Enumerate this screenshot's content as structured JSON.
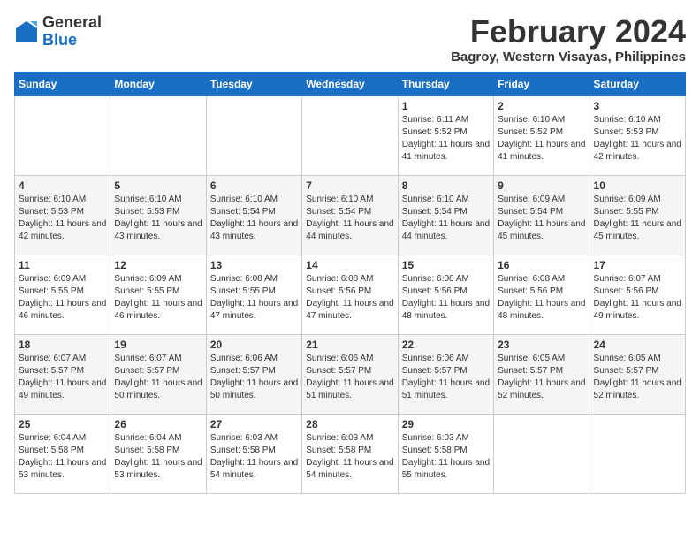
{
  "header": {
    "logo_general": "General",
    "logo_blue": "Blue",
    "month_year": "February 2024",
    "location": "Bagroy, Western Visayas, Philippines"
  },
  "calendar": {
    "days_of_week": [
      "Sunday",
      "Monday",
      "Tuesday",
      "Wednesday",
      "Thursday",
      "Friday",
      "Saturday"
    ],
    "weeks": [
      [
        {
          "day": "",
          "info": ""
        },
        {
          "day": "",
          "info": ""
        },
        {
          "day": "",
          "info": ""
        },
        {
          "day": "",
          "info": ""
        },
        {
          "day": "1",
          "info": "Sunrise: 6:11 AM\nSunset: 5:52 PM\nDaylight: 11 hours and 41 minutes."
        },
        {
          "day": "2",
          "info": "Sunrise: 6:10 AM\nSunset: 5:52 PM\nDaylight: 11 hours and 41 minutes."
        },
        {
          "day": "3",
          "info": "Sunrise: 6:10 AM\nSunset: 5:53 PM\nDaylight: 11 hours and 42 minutes."
        }
      ],
      [
        {
          "day": "4",
          "info": "Sunrise: 6:10 AM\nSunset: 5:53 PM\nDaylight: 11 hours and 42 minutes."
        },
        {
          "day": "5",
          "info": "Sunrise: 6:10 AM\nSunset: 5:53 PM\nDaylight: 11 hours and 43 minutes."
        },
        {
          "day": "6",
          "info": "Sunrise: 6:10 AM\nSunset: 5:54 PM\nDaylight: 11 hours and 43 minutes."
        },
        {
          "day": "7",
          "info": "Sunrise: 6:10 AM\nSunset: 5:54 PM\nDaylight: 11 hours and 44 minutes."
        },
        {
          "day": "8",
          "info": "Sunrise: 6:10 AM\nSunset: 5:54 PM\nDaylight: 11 hours and 44 minutes."
        },
        {
          "day": "9",
          "info": "Sunrise: 6:09 AM\nSunset: 5:54 PM\nDaylight: 11 hours and 45 minutes."
        },
        {
          "day": "10",
          "info": "Sunrise: 6:09 AM\nSunset: 5:55 PM\nDaylight: 11 hours and 45 minutes."
        }
      ],
      [
        {
          "day": "11",
          "info": "Sunrise: 6:09 AM\nSunset: 5:55 PM\nDaylight: 11 hours and 46 minutes."
        },
        {
          "day": "12",
          "info": "Sunrise: 6:09 AM\nSunset: 5:55 PM\nDaylight: 11 hours and 46 minutes."
        },
        {
          "day": "13",
          "info": "Sunrise: 6:08 AM\nSunset: 5:55 PM\nDaylight: 11 hours and 47 minutes."
        },
        {
          "day": "14",
          "info": "Sunrise: 6:08 AM\nSunset: 5:56 PM\nDaylight: 11 hours and 47 minutes."
        },
        {
          "day": "15",
          "info": "Sunrise: 6:08 AM\nSunset: 5:56 PM\nDaylight: 11 hours and 48 minutes."
        },
        {
          "day": "16",
          "info": "Sunrise: 6:08 AM\nSunset: 5:56 PM\nDaylight: 11 hours and 48 minutes."
        },
        {
          "day": "17",
          "info": "Sunrise: 6:07 AM\nSunset: 5:56 PM\nDaylight: 11 hours and 49 minutes."
        }
      ],
      [
        {
          "day": "18",
          "info": "Sunrise: 6:07 AM\nSunset: 5:57 PM\nDaylight: 11 hours and 49 minutes."
        },
        {
          "day": "19",
          "info": "Sunrise: 6:07 AM\nSunset: 5:57 PM\nDaylight: 11 hours and 50 minutes."
        },
        {
          "day": "20",
          "info": "Sunrise: 6:06 AM\nSunset: 5:57 PM\nDaylight: 11 hours and 50 minutes."
        },
        {
          "day": "21",
          "info": "Sunrise: 6:06 AM\nSunset: 5:57 PM\nDaylight: 11 hours and 51 minutes."
        },
        {
          "day": "22",
          "info": "Sunrise: 6:06 AM\nSunset: 5:57 PM\nDaylight: 11 hours and 51 minutes."
        },
        {
          "day": "23",
          "info": "Sunrise: 6:05 AM\nSunset: 5:57 PM\nDaylight: 11 hours and 52 minutes."
        },
        {
          "day": "24",
          "info": "Sunrise: 6:05 AM\nSunset: 5:57 PM\nDaylight: 11 hours and 52 minutes."
        }
      ],
      [
        {
          "day": "25",
          "info": "Sunrise: 6:04 AM\nSunset: 5:58 PM\nDaylight: 11 hours and 53 minutes."
        },
        {
          "day": "26",
          "info": "Sunrise: 6:04 AM\nSunset: 5:58 PM\nDaylight: 11 hours and 53 minutes."
        },
        {
          "day": "27",
          "info": "Sunrise: 6:03 AM\nSunset: 5:58 PM\nDaylight: 11 hours and 54 minutes."
        },
        {
          "day": "28",
          "info": "Sunrise: 6:03 AM\nSunset: 5:58 PM\nDaylight: 11 hours and 54 minutes."
        },
        {
          "day": "29",
          "info": "Sunrise: 6:03 AM\nSunset: 5:58 PM\nDaylight: 11 hours and 55 minutes."
        },
        {
          "day": "",
          "info": ""
        },
        {
          "day": "",
          "info": ""
        }
      ]
    ]
  }
}
